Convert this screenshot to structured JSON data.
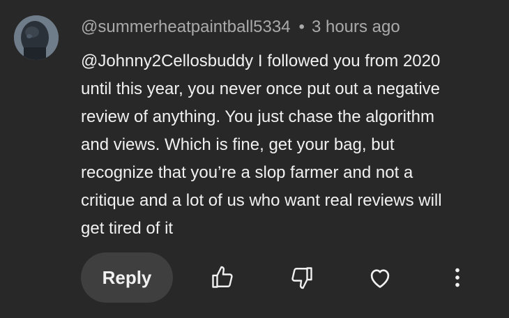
{
  "comment": {
    "author": "@summerheatpaintball5334",
    "separator": "•",
    "timestamp": "3 hours ago",
    "lines": [
      "@Johnny2Cellosbuddy I followed you from 2020",
      "until this year, you never once put out a negative",
      "review of anything. You just chase the algorithm",
      "and views. Which is fine, get your bag, but",
      "recognize that you’re a slop farmer and not a",
      "critique and a lot of us who want real reviews will",
      "get tired of it"
    ]
  },
  "actions": {
    "reply_label": "Reply",
    "icons": [
      "thumbs-up-icon",
      "thumbs-down-icon",
      "heart-icon",
      "more-vertical-icon"
    ]
  },
  "colors": {
    "background": "#282828",
    "text": "#f1f1f1",
    "meta_text": "#aaaaaa",
    "reply_button_bg": "#3f3f3f"
  }
}
